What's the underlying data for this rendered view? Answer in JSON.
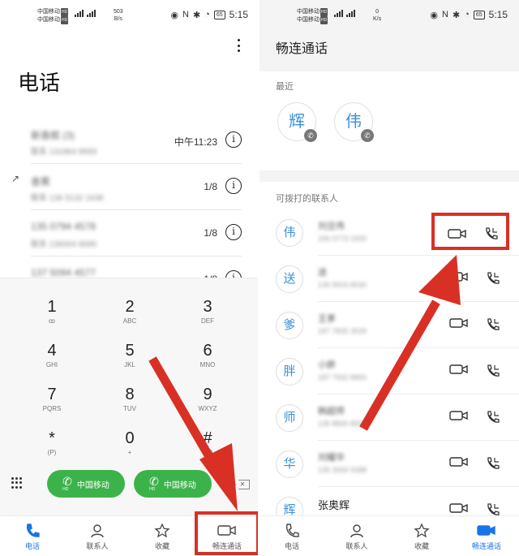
{
  "left": {
    "status": {
      "carrier1": "中国移动",
      "carrier2": "中国移动",
      "hd": "HD",
      "speed": "503",
      "speed_unit": "B/s",
      "nfc": "N",
      "battery": "65",
      "time": "5:15"
    },
    "title": "电话",
    "calls": [
      {
        "name": "新香槟 (3)",
        "number": "联系 131864 8659",
        "meta": "中午11:23",
        "info": "i",
        "outgoing": false
      },
      {
        "name": "香蕉",
        "number": "联系 136 5132 1638",
        "meta": "1/8",
        "info": "i",
        "outgoing": true
      },
      {
        "name": "135 0794 4578",
        "number": "联系 136004 8695",
        "meta": "1/8",
        "info": "i",
        "outgoing": false
      },
      {
        "name": "137 5094 4577",
        "number": "",
        "meta": "1/8",
        "info": "i",
        "outgoing": false
      }
    ],
    "keys": [
      {
        "digit": "1",
        "letters": "ꝏ"
      },
      {
        "digit": "2",
        "letters": "ABC"
      },
      {
        "digit": "3",
        "letters": "DEF"
      },
      {
        "digit": "4",
        "letters": "GHI"
      },
      {
        "digit": "5",
        "letters": "JKL"
      },
      {
        "digit": "6",
        "letters": "MNO"
      },
      {
        "digit": "7",
        "letters": "PQRS"
      },
      {
        "digit": "8",
        "letters": "TUV"
      },
      {
        "digit": "9",
        "letters": "WXYZ"
      },
      {
        "digit": "*",
        "letters": "(P)"
      },
      {
        "digit": "0",
        "letters": "+"
      },
      {
        "digit": "#",
        "letters": "(W)"
      }
    ],
    "sim1": {
      "label": "中国移动",
      "slot": "1",
      "hd": "HD"
    },
    "sim2": {
      "label": "中国移动",
      "slot": "2",
      "hd": "HD"
    },
    "backspace": "✕",
    "nav": [
      {
        "label": "电话",
        "icon": "phone-icon",
        "active": true
      },
      {
        "label": "联系人",
        "icon": "contacts-icon",
        "active": false
      },
      {
        "label": "收藏",
        "icon": "star-icon",
        "active": false
      },
      {
        "label": "畅连通话",
        "icon": "video-call-icon",
        "active": false
      }
    ]
  },
  "right": {
    "status": {
      "carrier1": "中国移动",
      "carrier2": "中国移动",
      "hd": "HD",
      "speed": "0",
      "speed_unit": "K/s",
      "nfc": "N",
      "battery": "65",
      "time": "5:15"
    },
    "title": "畅连通话",
    "recent_label": "最近",
    "recent": [
      {
        "char": "辉"
      },
      {
        "char": "伟"
      }
    ],
    "contacts_label": "可拨打的联系人",
    "contacts": [
      {
        "char": "伟",
        "name": "刘旦伟",
        "number": "156 0773 1930"
      },
      {
        "char": "送",
        "name": "送",
        "number": "135 9503 8530"
      },
      {
        "char": "爹",
        "name": "王爹",
        "number": "187 7835 3539"
      },
      {
        "char": "胖",
        "name": "小胖",
        "number": "187 7932 8850"
      },
      {
        "char": "师",
        "name": "韩超师",
        "number": "135 8830 8551"
      },
      {
        "char": "华",
        "name": "刘耀华",
        "number": "135 3059 9388"
      },
      {
        "char": "辉",
        "name": "张奥辉",
        "number": ""
      }
    ],
    "nav": [
      {
        "label": "电话",
        "icon": "phone-icon",
        "active": false
      },
      {
        "label": "联系人",
        "icon": "contacts-icon",
        "active": false
      },
      {
        "label": "收藏",
        "icon": "star-icon",
        "active": false
      },
      {
        "label": "畅连通话",
        "icon": "video-call-icon",
        "active": true
      }
    ]
  },
  "colors": {
    "accent": "#1a73e8",
    "green": "#3cb34a",
    "annotation_red": "#d93025",
    "avatar_text": "#3a8fd6"
  }
}
